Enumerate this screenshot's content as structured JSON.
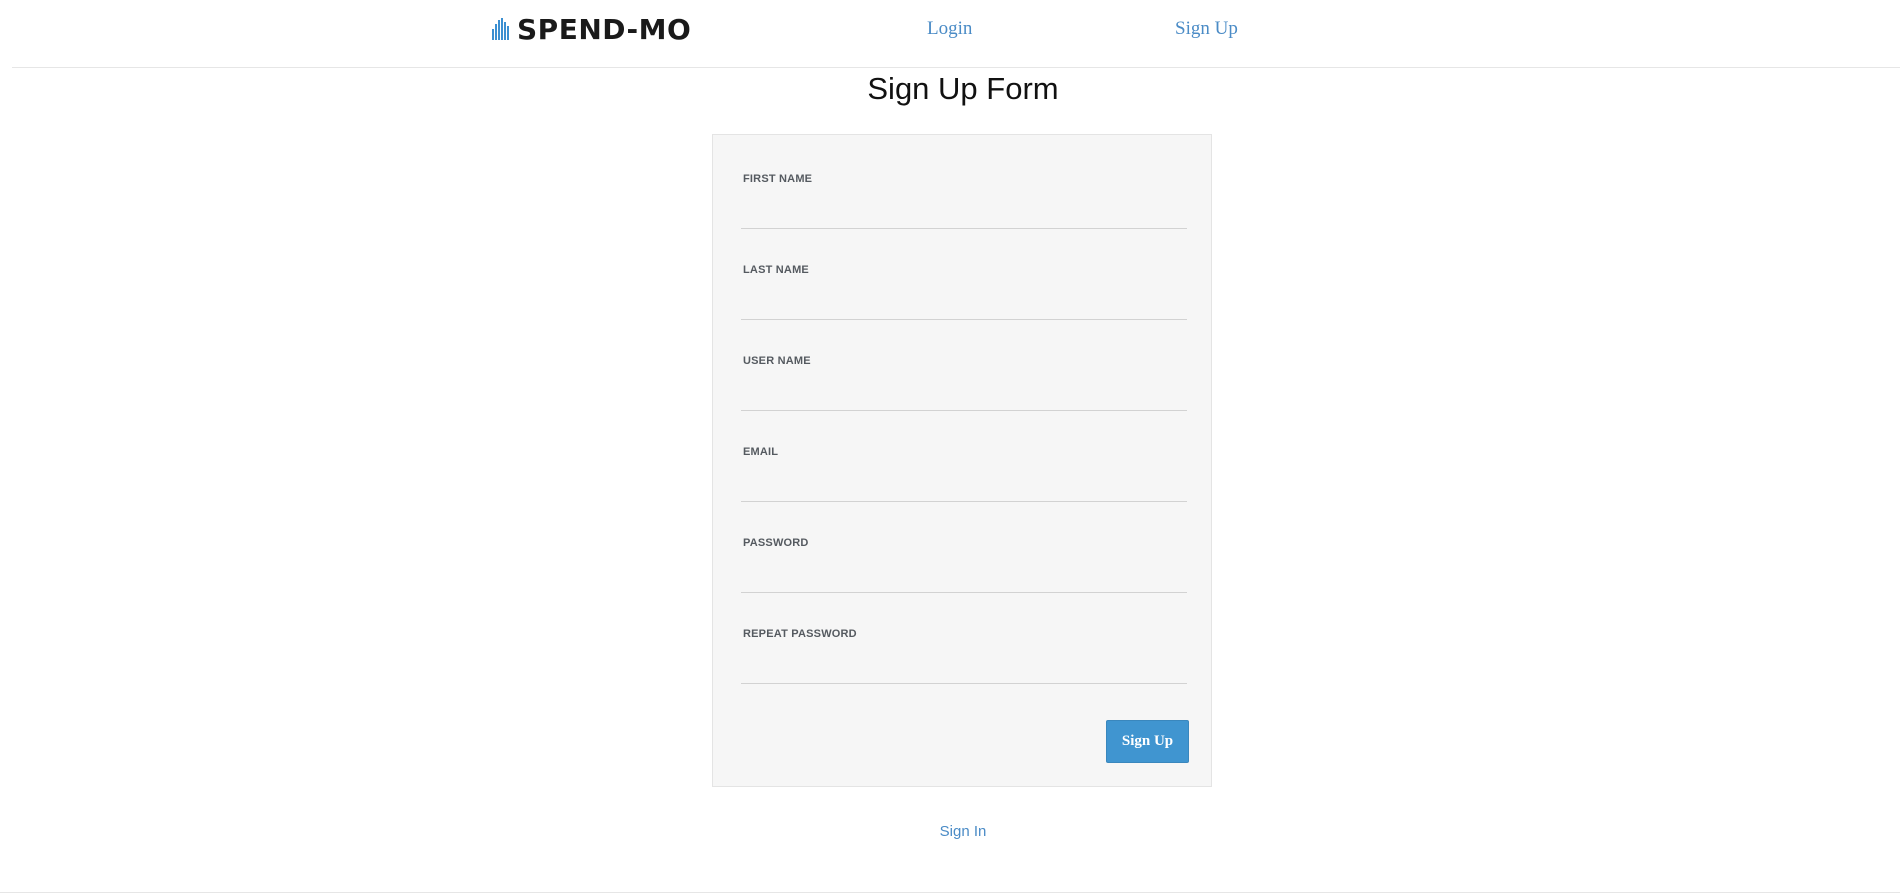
{
  "header": {
    "brand": "SPEND-MO",
    "brand_icon": "bar-chart-icon",
    "brand_color": "#1a1a1a",
    "icon_color": "#3b8fd1",
    "nav": {
      "login": "Login",
      "signup": "Sign Up"
    },
    "link_color": "#4a8bc6"
  },
  "main": {
    "title": "Sign Up Form",
    "form": {
      "fields": [
        {
          "label": "FIRST NAME",
          "value": "",
          "placeholder": ""
        },
        {
          "label": "LAST NAME",
          "value": "",
          "placeholder": ""
        },
        {
          "label": "USER NAME",
          "value": "",
          "placeholder": ""
        },
        {
          "label": "EMAIL",
          "value": "",
          "placeholder": ""
        },
        {
          "label": "PASSWORD",
          "value": "",
          "placeholder": ""
        },
        {
          "label": "REPEAT PASSWORD",
          "value": "",
          "placeholder": ""
        }
      ],
      "submit_label": "Sign Up",
      "submit_color": "#4095d0",
      "panel_color": "#f6f6f6"
    },
    "signin_link": "Sign In"
  }
}
